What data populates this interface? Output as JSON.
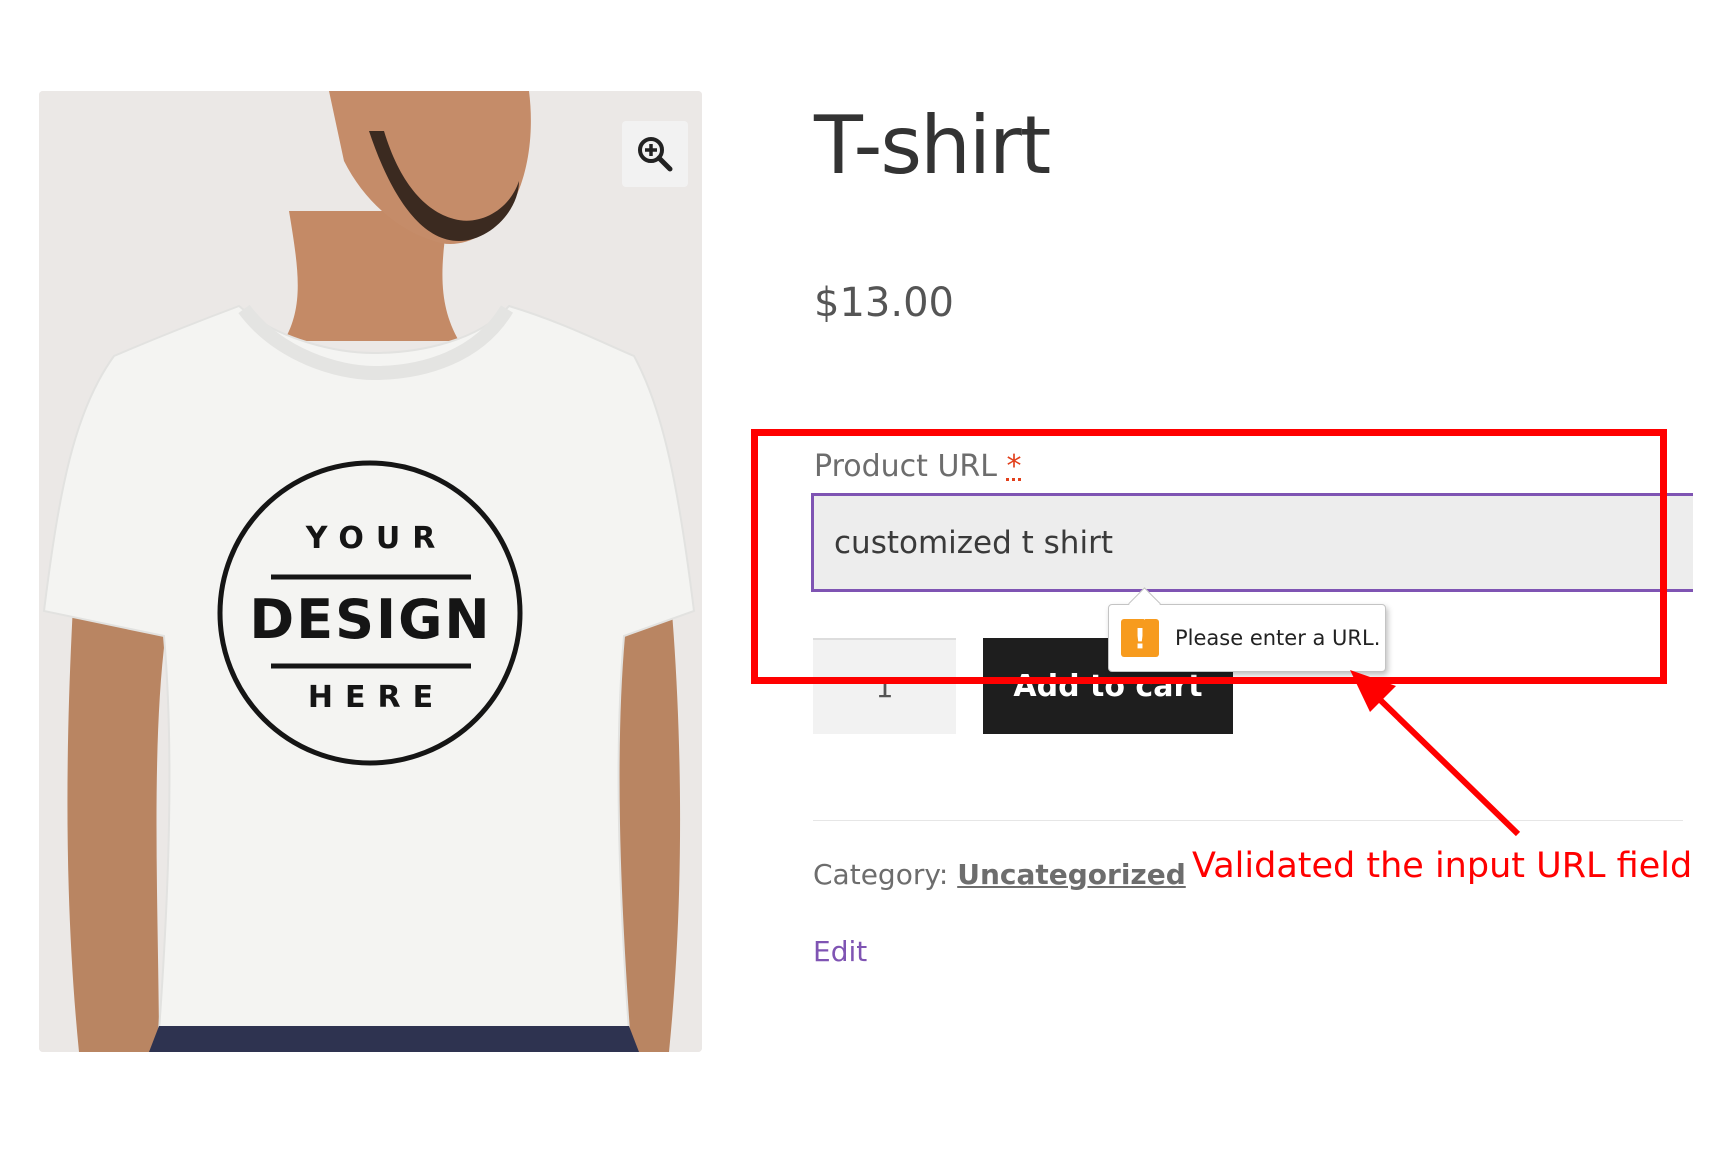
{
  "product": {
    "title": "T-shirt",
    "price": "$13.00",
    "image": {
      "print_line_1": "YOUR",
      "print_line_2": "DESIGN",
      "print_line_3": "HERE",
      "zoom_icon": "zoom-in-icon"
    }
  },
  "form": {
    "url_label": "Product URL",
    "required_marker": "*",
    "url_value": "customized t shirt",
    "quantity_value": "1",
    "add_to_cart_label": "Add to cart"
  },
  "validation": {
    "icon": "warning-icon",
    "icon_glyph": "!",
    "message": "Please enter a URL."
  },
  "meta": {
    "category_label": "Category:",
    "category_value": "Uncategorized",
    "edit_label": "Edit"
  },
  "annotation": {
    "text": "Validated the input URL field",
    "color": "#ff0000"
  },
  "colors": {
    "accent": "#7f54b3",
    "button_bg": "#1e1e1e",
    "warning": "#f79b1e"
  }
}
